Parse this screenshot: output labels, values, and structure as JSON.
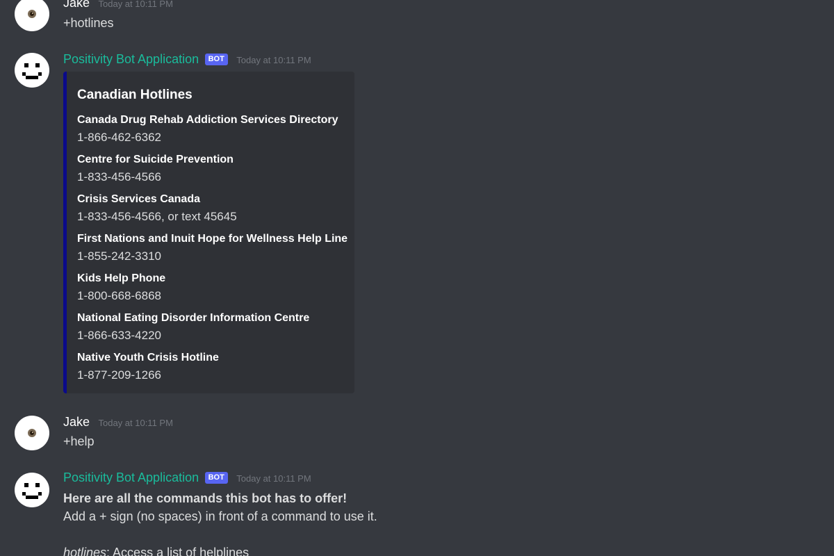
{
  "messages": {
    "jake_hotlines": {
      "username": "Jake",
      "timestamp": "Today at 10:11 PM",
      "text": "+hotlines"
    },
    "bot_hotlines": {
      "username": "Positivity Bot Application",
      "bot_tag": "BOT",
      "timestamp": "Today at 10:11 PM",
      "embed": {
        "title": "Canadian Hotlines",
        "fields": [
          {
            "name": "Canada Drug Rehab Addiction Services Directory",
            "value": "1-866-462-6362"
          },
          {
            "name": "Centre for Suicide Prevention",
            "value": "1-833-456-4566"
          },
          {
            "name": "Crisis Services Canada",
            "value": "1-833-456-4566, or text 45645"
          },
          {
            "name": "First Nations and Inuit Hope for Wellness Help Line",
            "value": "1-855-242-3310"
          },
          {
            "name": "Kids Help Phone",
            "value": "1-800-668-6868"
          },
          {
            "name": "National Eating Disorder Information Centre",
            "value": "1-866-633-4220"
          },
          {
            "name": "Native Youth Crisis Hotline",
            "value": "1-877-209-1266"
          }
        ],
        "accent_color": "#0a0a8a"
      }
    },
    "jake_help": {
      "username": "Jake",
      "timestamp": "Today at 10:11 PM",
      "text": "+help"
    },
    "bot_help": {
      "username": "Positivity Bot Application",
      "bot_tag": "BOT",
      "timestamp": "Today at 10:11 PM",
      "heading": "Here are all the commands this bot has to offer!",
      "instruction": "Add a + sign (no spaces) in front of a command to use it.",
      "command_name": "hotlines",
      "command_desc": ": Access a list of helplines"
    }
  },
  "icons": {
    "user_avatar": "eye-avatar-icon",
    "bot_avatar": "smiley-avatar-icon"
  },
  "colors": {
    "background": "#36393f",
    "embed_background": "#2f3136",
    "bot_name": "#1abc9c",
    "bot_tag": "#5865f2",
    "timestamp": "#72767d"
  }
}
